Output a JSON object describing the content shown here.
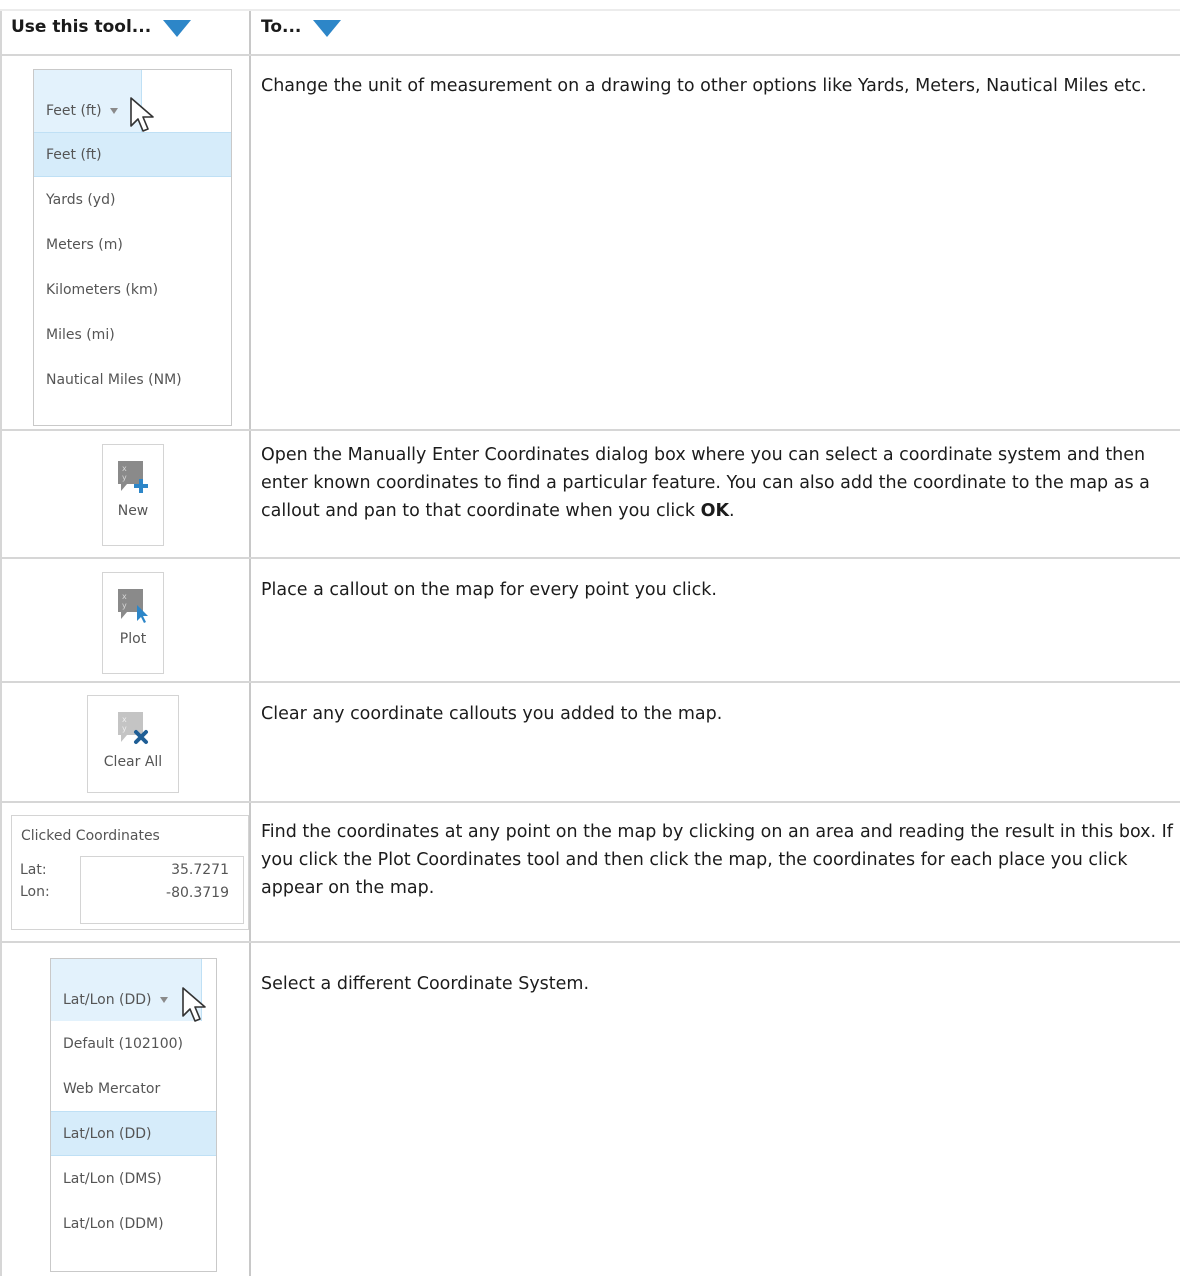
{
  "header": {
    "col1": "Use this tool...",
    "col2": "To..."
  },
  "rows": {
    "units": {
      "dropdown": {
        "current": "Feet (ft)",
        "options": [
          "Feet (ft)",
          "Yards (yd)",
          "Meters (m)",
          "Kilometers (km)",
          "Miles (mi)",
          "Nautical Miles (NM)"
        ],
        "selected_index": 0
      },
      "description": "Change the unit of measurement on a drawing to other options like Yards, Meters, Nautical Miles etc."
    },
    "new": {
      "label": "New",
      "description_before": "Open the Manually Enter Coordinates dialog box where you can select a coordinate system and then enter known coordinates to find a particular feature. You can also add the coordinate to the map as a callout and pan to that coordinate when you click ",
      "description_bold": "OK",
      "description_after": "."
    },
    "plot": {
      "label": "Plot",
      "description": "Place a callout on the map for every point you click."
    },
    "clear_all": {
      "label": "Clear All",
      "description": "Clear any coordinate callouts you added to the map."
    },
    "clicked_coordinates": {
      "title": "Clicked Coordinates",
      "lat_label": "Lat:",
      "lat_value": "35.7271",
      "lon_label": "Lon:",
      "lon_value": "-80.3719",
      "description": "Find the coordinates at any point on the map by clicking on an area and reading the result in this box. If you click the Plot Coordinates tool and then click the map, the coordinates for each place you click appear on the map."
    },
    "coord_system": {
      "dropdown": {
        "current": "Lat/Lon (DD)",
        "options": [
          "Default (102100)",
          "Web Mercator",
          "Lat/Lon (DD)",
          "Lat/Lon (DMS)",
          "Lat/Lon (DDM)"
        ],
        "selected_index": 2
      },
      "description": "Select a different Coordinate System."
    }
  },
  "colors": {
    "accent": "#2d86c8",
    "selection": "#d6ecfa",
    "grid": "#c8c8c8"
  }
}
